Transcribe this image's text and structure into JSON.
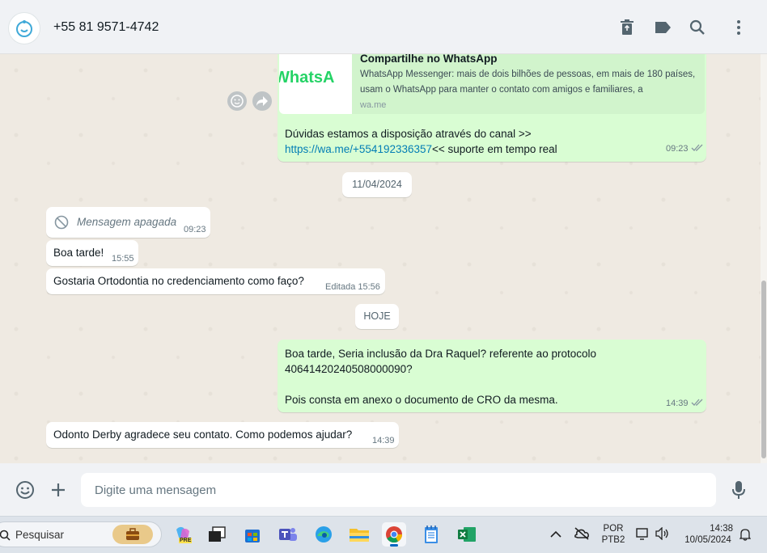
{
  "header": {
    "contact": "+55 81 9571-4742",
    "icons": [
      "delete-icon",
      "label-icon",
      "search-icon",
      "menu-icon"
    ]
  },
  "messages": {
    "m1": {
      "preview_title": "Compartilhe no WhatsApp",
      "preview_desc": "WhatsApp Messenger: mais de dois bilhões de pessoas, em mais de 180 países, usam o WhatsApp para manter o contato com amigos e familiares, a",
      "preview_domain": "wa.me",
      "preview_logo": "WhatsA",
      "line1": "Dúvidas estamos a disposição através do canal >>",
      "link": "https://wa.me/+554192336357",
      "line2_rest": "<< suporte em tempo real",
      "time": "09:23"
    },
    "date1": "11/04/2024",
    "m2": {
      "text": "Mensagem apagada",
      "time": "09:23"
    },
    "m3": {
      "text": "Boa tarde!",
      "time": "15:55"
    },
    "m4": {
      "text": "Gostaria Ortodontia no credenciamento como faço?",
      "edited": "Editada",
      "time": "15:56"
    },
    "date2": "HOJE",
    "m5": {
      "line1": "Boa tarde, Seria inclusão da Dra Raquel? referente ao protocolo",
      "line2": "40641420240508000090?",
      "line3": "Pois consta em anexo o documento de CRO da mesma.",
      "time": "14:39"
    },
    "m6": {
      "text": "Odonto Derby agradece seu contato. Como podemos ajudar?",
      "time": "14:39"
    }
  },
  "footer": {
    "placeholder": "Digite uma mensagem"
  },
  "taskbar": {
    "search": "Pesquisar",
    "lang1": "POR",
    "lang2": "PTB2",
    "time": "14:38",
    "date": "10/05/2024",
    "copilot_badge": "PRE"
  },
  "colors": {
    "outgoing": "#d9fdd3",
    "incoming": "#ffffff",
    "link": "#027eb5",
    "background": "#efeae2"
  }
}
